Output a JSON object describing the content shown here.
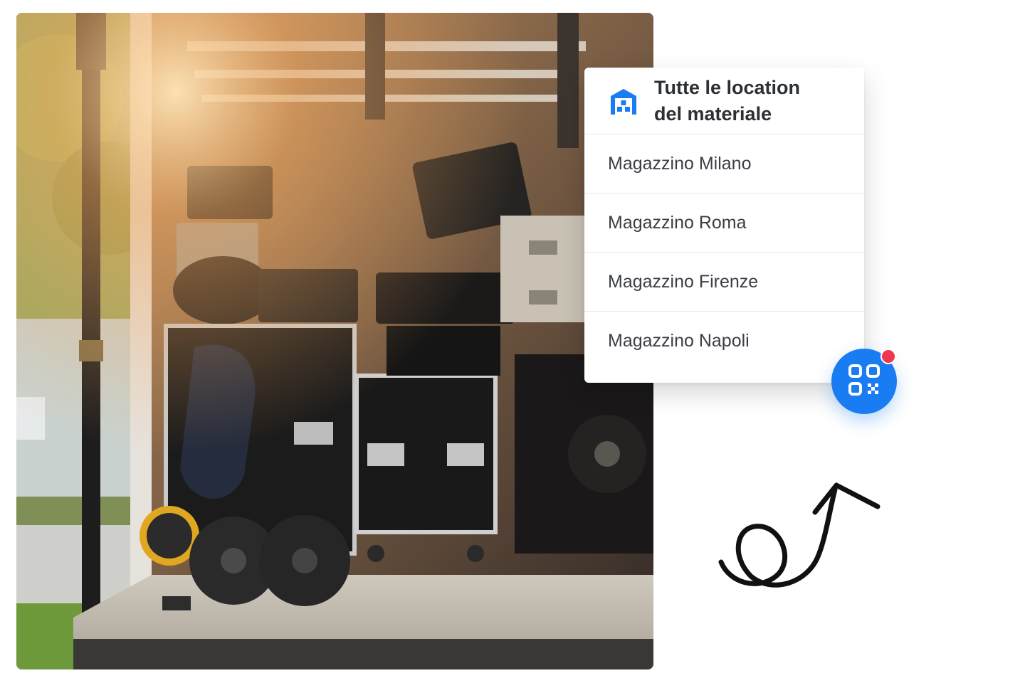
{
  "card": {
    "title": "Tutte le location del materiale",
    "icon": "warehouse-icon",
    "locations": [
      "Magazzino Milano",
      "Magazzino Roma",
      "Magazzino Firenze",
      "Magazzino Napoli"
    ]
  },
  "fab": {
    "icon": "qr-code-icon",
    "notification": true
  },
  "colors": {
    "accent": "#1a7cf2",
    "notification": "#f0364f",
    "text": "#2c2f33"
  }
}
